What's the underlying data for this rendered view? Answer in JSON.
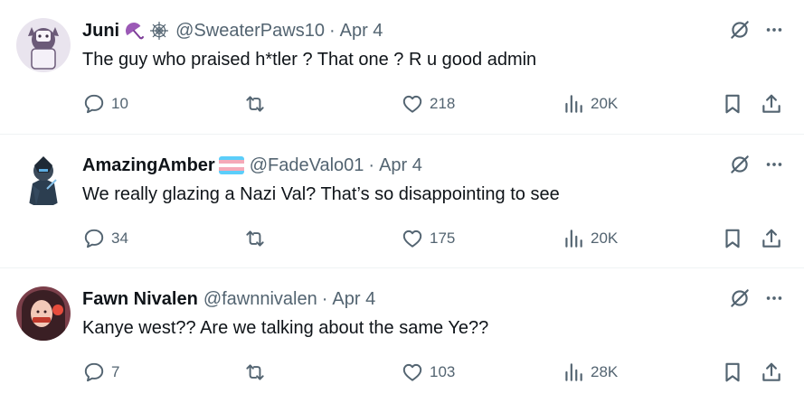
{
  "posts": [
    {
      "name": "Juni",
      "name_emojis": [
        "umbrella-icon",
        "spider-web-icon"
      ],
      "handle": "@SweaterPaws10",
      "separator": "·",
      "date": "Apr 4",
      "text": "The guy who praised h*tler ? That one ? R u good admin",
      "replies": "10",
      "reposts": "",
      "likes": "218",
      "views": "20K"
    },
    {
      "name": "AmazingAmber",
      "name_emojis": [
        "transgender-flag-icon"
      ],
      "handle": "@FadeValo01",
      "separator": "·",
      "date": "Apr 4",
      "text": "We really glazing a Nazi Val? That’s so disappointing to see",
      "replies": "34",
      "reposts": "",
      "likes": "175",
      "views": "20K"
    },
    {
      "name": "Fawn Nivalen",
      "name_emojis": [],
      "handle": "@fawnnivalen",
      "separator": "·",
      "date": "Apr 4",
      "text": "Kanye west?? Are we talking about the same Ye??",
      "replies": "7",
      "reposts": "",
      "likes": "103",
      "views": "28K"
    }
  ],
  "colors": {
    "text_primary": "#0f1419",
    "text_secondary": "#536471",
    "divider": "#eff3f4"
  }
}
